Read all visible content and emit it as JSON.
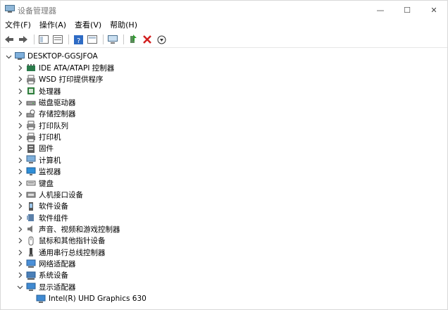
{
  "window": {
    "title": "设备管理器",
    "minimize_label": "—",
    "maximize_label": "☐",
    "close_label": "✕"
  },
  "menu": [
    "文件(F)",
    "操作(A)",
    "查看(V)",
    "帮助(H)"
  ],
  "toolbar": {
    "icons": [
      "back-arrow-icon",
      "forward-arrow-icon",
      "show-hide-tree-icon",
      "properties-icon",
      "help-icon",
      "view-icon",
      "scan-hardware-icon",
      "update-driver-icon",
      "uninstall-icon",
      "disable-icon"
    ]
  },
  "tree": {
    "root": "DESKTOP-GGSJFOA",
    "items": [
      {
        "label": "IDE ATA/ATAPI 控制器",
        "icon": "ide-controller-icon"
      },
      {
        "label": "WSD 打印提供程序",
        "icon": "printer-provider-icon"
      },
      {
        "label": "处理器",
        "icon": "processor-icon"
      },
      {
        "label": "磁盘驱动器",
        "icon": "disk-drive-icon"
      },
      {
        "label": "存储控制器",
        "icon": "storage-controller-icon"
      },
      {
        "label": "打印队列",
        "icon": "print-queue-icon"
      },
      {
        "label": "打印机",
        "icon": "printer-icon"
      },
      {
        "label": "固件",
        "icon": "firmware-icon"
      },
      {
        "label": "计算机",
        "icon": "computer-icon"
      },
      {
        "label": "监视器",
        "icon": "monitor-icon"
      },
      {
        "label": "键盘",
        "icon": "keyboard-icon"
      },
      {
        "label": "人机接口设备",
        "icon": "hid-icon"
      },
      {
        "label": "软件设备",
        "icon": "software-device-icon"
      },
      {
        "label": "软件组件",
        "icon": "software-component-icon"
      },
      {
        "label": "声音、视频和游戏控制器",
        "icon": "sound-icon"
      },
      {
        "label": "鼠标和其他指针设备",
        "icon": "mouse-icon"
      },
      {
        "label": "通用串行总线控制器",
        "icon": "usb-icon"
      },
      {
        "label": "网络适配器",
        "icon": "network-adapter-icon"
      },
      {
        "label": "系统设备",
        "icon": "system-device-icon"
      },
      {
        "label": "显示适配器",
        "icon": "display-adapter-icon",
        "expanded": true
      }
    ],
    "children": [
      {
        "label": "Intel(R) UHD Graphics 630",
        "icon": "display-adapter-icon"
      }
    ]
  }
}
